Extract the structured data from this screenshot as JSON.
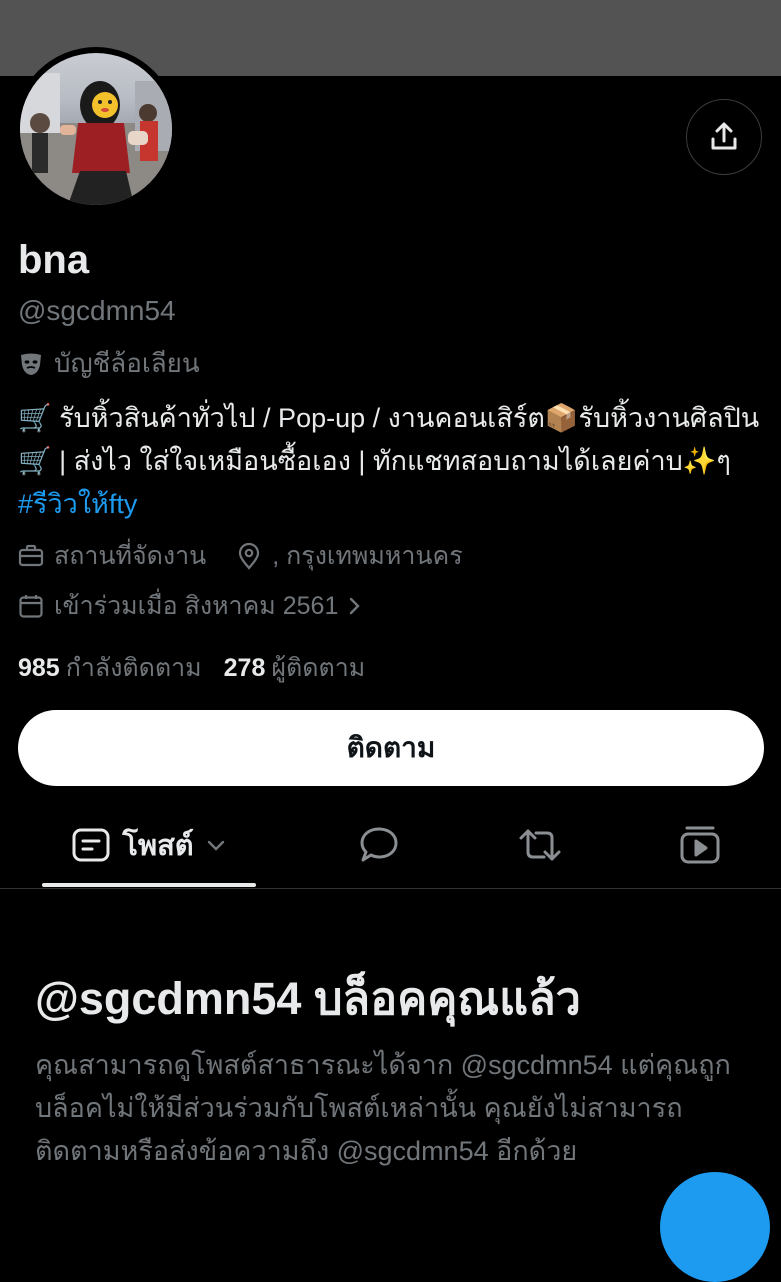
{
  "profile": {
    "name": "bna",
    "handle": "@sgcdmn54",
    "parody_label": "บัญชีล้อเลียน",
    "bio_part1": "🛒 รับหิ้วสินค้าทั่วไป / Pop-up / งานคอนเสิร์ต📦รับหิ้วงานศิลปิน 🛒 | ส่งไว ใส่ใจเหมือนซื้อเอง | ทักแชทสอบถามได้เลยค่าบ✨ๆ ",
    "bio_hashtag": "#รีวิวให้fty",
    "category": "สถานที่จัดงาน",
    "location": ", กรุงเทพมหานคร",
    "joined": "เข้าร่วมเมื่อ สิงหาคม 2561"
  },
  "stats": {
    "following_count": "985",
    "following_label": "กำลังติดตาม",
    "followers_count": "278",
    "followers_label": "ผู้ติดตาม"
  },
  "actions": {
    "follow_label": "ติดตาม"
  },
  "tabs": {
    "posts_label": "โพสต์"
  },
  "blocked": {
    "title": "@sgcdmn54 บล็อคคุณแล้ว",
    "body": "คุณสามารถดูโพสต์สาธารณะได้จาก @sgcdmn54 แต่คุณถูกบล็อคไม่ให้มีส่วนร่วมกับโพสต์เหล่านั้น คุณยังไม่สามารถติดตามหรือส่งข้อความถึง @sgcdmn54 อีกด้วย"
  },
  "colors": {
    "background": "#000000",
    "banner": "#535353",
    "secondary_text": "#71767b",
    "accent": "#1d9bf0"
  }
}
